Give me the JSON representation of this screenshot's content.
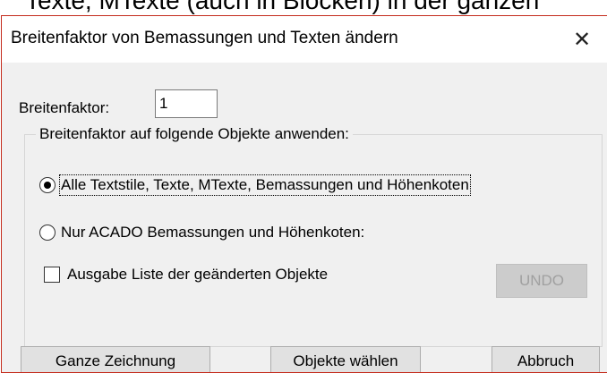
{
  "background": {
    "text": "Texte, MTexte (auch in Blöcken) in der ganzen"
  },
  "dialog": {
    "title": "Breitenfaktor von Bemassungen und Texten ändern",
    "close_glyph": "✕"
  },
  "form": {
    "factor_label": "Breitenfaktor:",
    "factor_value": "1",
    "group_title": "Breitenfaktor auf folgende Objekte anwenden:",
    "options": [
      {
        "label": "Alle Textstile, Texte, MTexte, Bemassungen und Höhenkoten",
        "selected": true
      },
      {
        "label": "Nur ACADO Bemassungen und Höhenkoten:",
        "selected": false
      }
    ],
    "checkbox": {
      "label": "Ausgabe Liste der geänderten Objekte",
      "checked": false
    },
    "undo_label": "UNDO"
  },
  "buttons": {
    "whole_drawing": "Ganze Zeichnung",
    "select_objects": "Objekte wählen",
    "cancel": "Abbruch"
  },
  "colors": {
    "dialog_bg": "#f0f0f0",
    "titlebar_bg": "#ffffff",
    "border_accent": "#c42b1c"
  }
}
